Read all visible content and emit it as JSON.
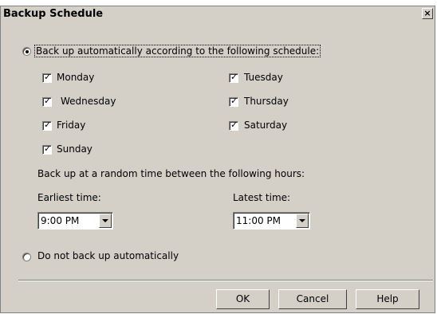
{
  "window": {
    "title": "Backup Schedule",
    "close_glyph": "×"
  },
  "schedule": {
    "auto_label": "Back up automatically according to the following schedule:",
    "auto_selected": true,
    "days": [
      {
        "label": "Monday",
        "checked": true
      },
      {
        "label": "Tuesday",
        "checked": true
      },
      {
        "label": "Wednesday",
        "checked": true
      },
      {
        "label": "Thursday",
        "checked": true
      },
      {
        "label": "Friday",
        "checked": true
      },
      {
        "label": "Saturday",
        "checked": true
      },
      {
        "label": "Sunday",
        "checked": true
      }
    ],
    "check_mark": "✓",
    "random_label": "Back up at a random time between the following hours:",
    "earliest_label": "Earliest time:",
    "earliest_value": "9:00 PM",
    "latest_label": "Latest time:",
    "latest_value": "11:00 PM",
    "manual_label": "Do not back up automatically",
    "manual_selected": false
  },
  "buttons": {
    "ok": "OK",
    "cancel": "Cancel",
    "help": "Help"
  },
  "icons": {
    "close": "close-icon",
    "dropdown": "chevron-down-icon"
  }
}
